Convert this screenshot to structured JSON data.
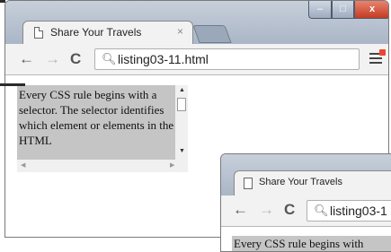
{
  "window": {
    "tab_title": "Share Your Travels",
    "tab_close": "×",
    "controls": {
      "minimize": "‒",
      "maximize": "□",
      "close": "x"
    }
  },
  "toolbar": {
    "back_icon": "←",
    "forward_icon": "→",
    "reload_icon": "C",
    "search_icon": "search-icon",
    "url": "listing03-11.html"
  },
  "content": {
    "textarea_text": "Every CSS rule begins with a selector. The selector identifies which element or elements in the HTML"
  },
  "window2": {
    "tab_title": "Share Your Travels",
    "tab_close": "×",
    "url": "listing03-1",
    "peek_text": "Every CSS rule begins with"
  },
  "colors": {
    "textarea_bg": "#c5c5c5",
    "close_button": "#c43c23",
    "titlebar": "#aab6c7"
  }
}
